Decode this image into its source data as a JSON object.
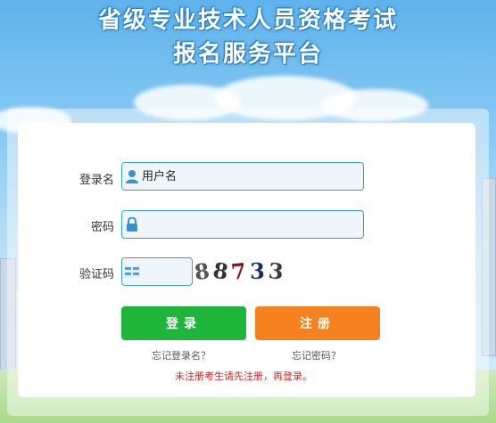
{
  "header": {
    "title_line1": "省级专业技术人员资格考试",
    "title_line2": "报名服务平台"
  },
  "form": {
    "username_label": "登录名",
    "username_placeholder": "用户名",
    "password_label": "密码",
    "password_placeholder": "",
    "captcha_label": "验证码",
    "captcha_icon_text": "验证码",
    "captcha_chars": [
      "8",
      "8",
      "7",
      "3",
      "3"
    ]
  },
  "buttons": {
    "login_label": "登录",
    "register_label": "注册",
    "login_color": "#1eb53a",
    "register_color": "#f5821f"
  },
  "links": {
    "forgot_username": "忘记登录名？",
    "forgot_password": "忘记密码？"
  },
  "notice": "未注册考生请先注册，再登录。",
  "icons": {
    "username": "user-icon",
    "password": "lock-icon",
    "captcha": "captcha-icon"
  }
}
